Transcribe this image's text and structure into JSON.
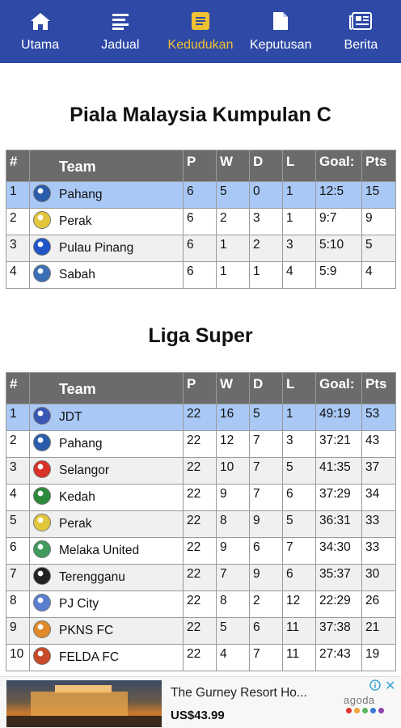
{
  "nav": {
    "items": [
      {
        "label": "Utama",
        "icon": "home-icon",
        "active": false
      },
      {
        "label": "Jadual",
        "icon": "list-icon",
        "active": false
      },
      {
        "label": "Kedudukan",
        "icon": "standings-icon",
        "active": true
      },
      {
        "label": "Keputusan",
        "icon": "document-icon",
        "active": false
      },
      {
        "label": "Berita",
        "icon": "newspaper-icon",
        "active": false
      }
    ],
    "colors": {
      "bar": "#2f4aa6",
      "label": "#ffffff",
      "active": "#f1c232"
    }
  },
  "headers": {
    "num": "#",
    "team": "Team",
    "p": "P",
    "w": "W",
    "d": "D",
    "l": "L",
    "goal": "Goal:",
    "pts": "Pts"
  },
  "sections": [
    {
      "title": "Piala Malaysia Kumpulan C",
      "rows": [
        {
          "pos": "1",
          "team": "Pahang",
          "p": "6",
          "w": "5",
          "d": "0",
          "l": "1",
          "goal": "12:5",
          "pts": "15",
          "crest": "#2a5caa",
          "highlight": true
        },
        {
          "pos": "2",
          "team": "Perak",
          "p": "6",
          "w": "2",
          "d": "3",
          "l": "1",
          "goal": "9:7",
          "pts": "9",
          "crest": "#e2c63c"
        },
        {
          "pos": "3",
          "team": "Pulau Pinang",
          "p": "6",
          "w": "1",
          "d": "2",
          "l": "3",
          "goal": "5:10",
          "pts": "5",
          "crest": "#1f55c8"
        },
        {
          "pos": "4",
          "team": "Sabah",
          "p": "6",
          "w": "1",
          "d": "1",
          "l": "4",
          "goal": "5:9",
          "pts": "4",
          "crest": "#3b6fb6"
        }
      ]
    },
    {
      "title": "Liga Super",
      "rows": [
        {
          "pos": "1",
          "team": "JDT",
          "p": "22",
          "w": "16",
          "d": "5",
          "l": "1",
          "goal": "49:19",
          "pts": "53",
          "crest": "#3a57b5",
          "highlight": true
        },
        {
          "pos": "2",
          "team": "Pahang",
          "p": "22",
          "w": "12",
          "d": "7",
          "l": "3",
          "goal": "37:21",
          "pts": "43",
          "crest": "#2a5caa"
        },
        {
          "pos": "3",
          "team": "Selangor",
          "p": "22",
          "w": "10",
          "d": "7",
          "l": "5",
          "goal": "41:35",
          "pts": "37",
          "crest": "#d8332b"
        },
        {
          "pos": "4",
          "team": "Kedah",
          "p": "22",
          "w": "9",
          "d": "7",
          "l": "6",
          "goal": "37:29",
          "pts": "34",
          "crest": "#2c8a3c"
        },
        {
          "pos": "5",
          "team": "Perak",
          "p": "22",
          "w": "8",
          "d": "9",
          "l": "5",
          "goal": "36:31",
          "pts": "33",
          "crest": "#e2c63c"
        },
        {
          "pos": "6",
          "team": "Melaka United",
          "p": "22",
          "w": "9",
          "d": "6",
          "l": "7",
          "goal": "34:30",
          "pts": "33",
          "crest": "#3f9a5c"
        },
        {
          "pos": "7",
          "team": "Terengganu",
          "p": "22",
          "w": "7",
          "d": "9",
          "l": "6",
          "goal": "35:37",
          "pts": "30",
          "crest": "#222222"
        },
        {
          "pos": "8",
          "team": "PJ City",
          "p": "22",
          "w": "8",
          "d": "2",
          "l": "12",
          "goal": "22:29",
          "pts": "26",
          "crest": "#5a7fd0"
        },
        {
          "pos": "9",
          "team": "PKNS FC",
          "p": "22",
          "w": "5",
          "d": "6",
          "l": "11",
          "goal": "37:38",
          "pts": "21",
          "crest": "#e08a2a"
        },
        {
          "pos": "10",
          "team": "FELDA FC",
          "p": "22",
          "w": "4",
          "d": "7",
          "l": "11",
          "goal": "27:43",
          "pts": "19",
          "crest": "#c84a2a"
        }
      ]
    }
  ],
  "ad": {
    "title": "The Gurney Resort Ho...",
    "price": "US$43.99",
    "brand": "agoda",
    "brand_dots": [
      "#e0322d",
      "#f4a23a",
      "#5cb85c",
      "#3a7ad6",
      "#8e44ad"
    ]
  }
}
